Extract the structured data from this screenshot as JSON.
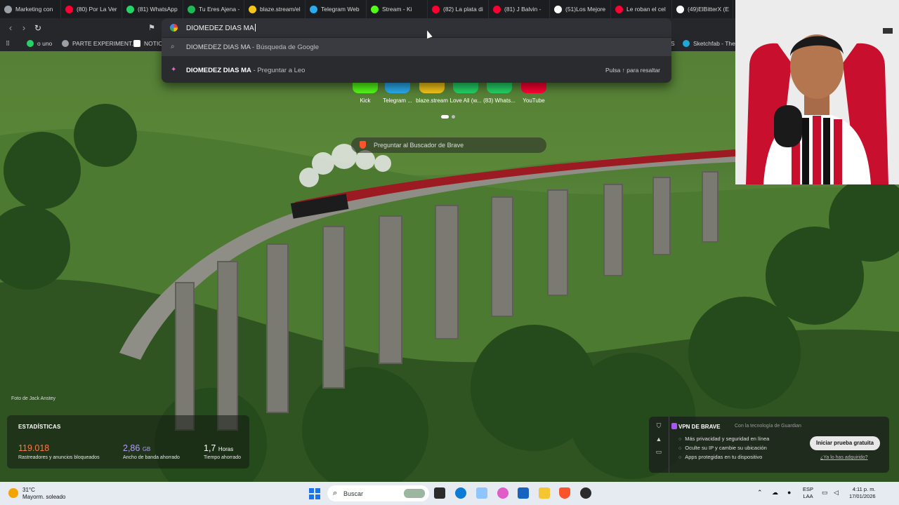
{
  "tabs": [
    {
      "title": "Marketing con",
      "icon": "gear-icon",
      "color": "#9aa0a6"
    },
    {
      "title": "(80) Por La Ver",
      "icon": "youtube-icon",
      "color": "#ff0033"
    },
    {
      "title": "(81) WhatsApp",
      "icon": "whatsapp-icon",
      "color": "#25d366"
    },
    {
      "title": "Tu Eres Ajena -",
      "icon": "spotify-icon",
      "color": "#1db954"
    },
    {
      "title": "blaze.stream/el",
      "icon": "blaze-icon",
      "color": "#f5c518"
    },
    {
      "title": "Telegram Web",
      "icon": "telegram-icon",
      "color": "#2aabee"
    },
    {
      "title": "Stream - Ki",
      "icon": "kick-icon",
      "color": "#53fc18"
    },
    {
      "title": "(82) La plata di",
      "icon": "youtube-icon",
      "color": "#ff0033"
    },
    {
      "title": "(81) J Balvin -",
      "icon": "youtube-icon",
      "color": "#ff0033"
    },
    {
      "title": "(51)Los Mejore",
      "icon": "tiktok-icon",
      "color": "#ffffff"
    },
    {
      "title": "Le roban el cel",
      "icon": "youtube-icon",
      "color": "#ff0033"
    },
    {
      "title": "(49)ElBitterX (E",
      "icon": "tiktok-icon",
      "color": "#ffffff"
    }
  ],
  "omnibox": {
    "value": "DIOMEDEZ DIAS MA",
    "suggestions": [
      {
        "query": "DIOMEDEZ DIAS MA",
        "suffix": " - Búsqueda de Google",
        "icon": "search-icon",
        "hint": ""
      },
      {
        "query": "DIOMEDEZ DIAS MA",
        "suffix": " - Preguntar a Leo",
        "icon": "leo-icon",
        "hint": "Pulsa ↑ para resaltar"
      }
    ]
  },
  "bookmarks": [
    {
      "label": "o uno",
      "icon": "whatsapp-icon",
      "color": "#25d366"
    },
    {
      "label": "PARTE EXPERIMENT...",
      "icon": "globe-icon",
      "color": "#9aa0a6"
    },
    {
      "label": "NOTIC",
      "icon": "notion-icon",
      "color": "#ffffff"
    },
    {
      "label": "S",
      "icon": "bookmark-icon",
      "color": "#9aa0a6"
    },
    {
      "label": "Sketchfab - The b",
      "icon": "sketchfab-icon",
      "color": "#1caad9"
    }
  ],
  "speed_dial": [
    {
      "label": "Kick",
      "color": "#53fc18"
    },
    {
      "label": "Telegram ...",
      "color": "#2aabee"
    },
    {
      "label": "blaze.stream",
      "color": "#f5c518"
    },
    {
      "label": "Love All (w...",
      "color": "#25d366"
    },
    {
      "label": "(83) Whats...",
      "color": "#25d366"
    },
    {
      "label": "YouTube",
      "color": "#ff0033"
    }
  ],
  "brave_search": {
    "placeholder": "Preguntar al Buscador de Brave"
  },
  "photo_credit": "Foto de Jack Anstey",
  "stats": {
    "heading": "ESTADÍSTICAS",
    "trackers": {
      "value": "119.018",
      "label": "Rastreadores y anuncios bloqueados",
      "color": "#ff7a45"
    },
    "bandwidth": {
      "value": "2,86",
      "unit": "GB",
      "label": "Ancho de banda ahorrado",
      "color": "#b39dff"
    },
    "time": {
      "value": "1,7",
      "unit": "Horas",
      "label": "Tiempo ahorrado",
      "color": "#ffffff"
    }
  },
  "vpn": {
    "title": "VPN DE BRAVE",
    "subtitle": "Con la tecnología de Guardian",
    "features": [
      "Más privacidad y seguridad en línea",
      "Oculte su IP y cambie su ubicación",
      "Apps protegidas en tu dispositivo"
    ],
    "cta": "Iniciar prueba gratuita",
    "already": "¿Ya lo has adquirido?"
  },
  "taskbar": {
    "weather": {
      "temp": "31°C",
      "desc": "Mayorm. soleado"
    },
    "search_label": "Buscar",
    "lang": {
      "top": "ESP",
      "bottom": "LAA"
    },
    "clock": {
      "time": "4:11 p. m.",
      "date": "17/01/2026"
    }
  }
}
